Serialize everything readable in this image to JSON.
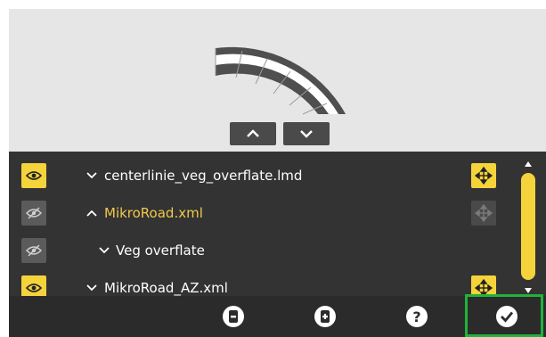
{
  "preview": {
    "nav_up_icon": "chevron-up-icon",
    "nav_down_icon": "chevron-down-icon",
    "colors": {
      "background": "#e6e6e6",
      "road_dark": "#4f4f4f",
      "road_light": "#ffffff"
    }
  },
  "layers": [
    {
      "label": "centerlinie_veg_overflate.lmd",
      "visible": true,
      "expanded": true,
      "selected": false,
      "level": 0,
      "movable": true
    },
    {
      "label": "MikroRoad.xml",
      "visible": false,
      "expanded": false,
      "selected": true,
      "level": 0,
      "movable": false
    },
    {
      "label": "Veg overflate",
      "visible": false,
      "expanded": true,
      "selected": false,
      "level": 1,
      "movable": null
    },
    {
      "label": "MikroRoad_AZ.xml",
      "visible": true,
      "expanded": true,
      "selected": false,
      "level": 0,
      "movable": true
    }
  ],
  "toolbar": {
    "items": [
      "remove-circle-icon",
      "add-file-icon",
      "help-icon",
      "confirm-check-icon"
    ]
  },
  "colors": {
    "accent": "#f5d33b",
    "selected_text": "#f2c94c",
    "panel": "#333333",
    "toolbar": "#2b2b2b",
    "confirm_border": "#1fb33a"
  }
}
